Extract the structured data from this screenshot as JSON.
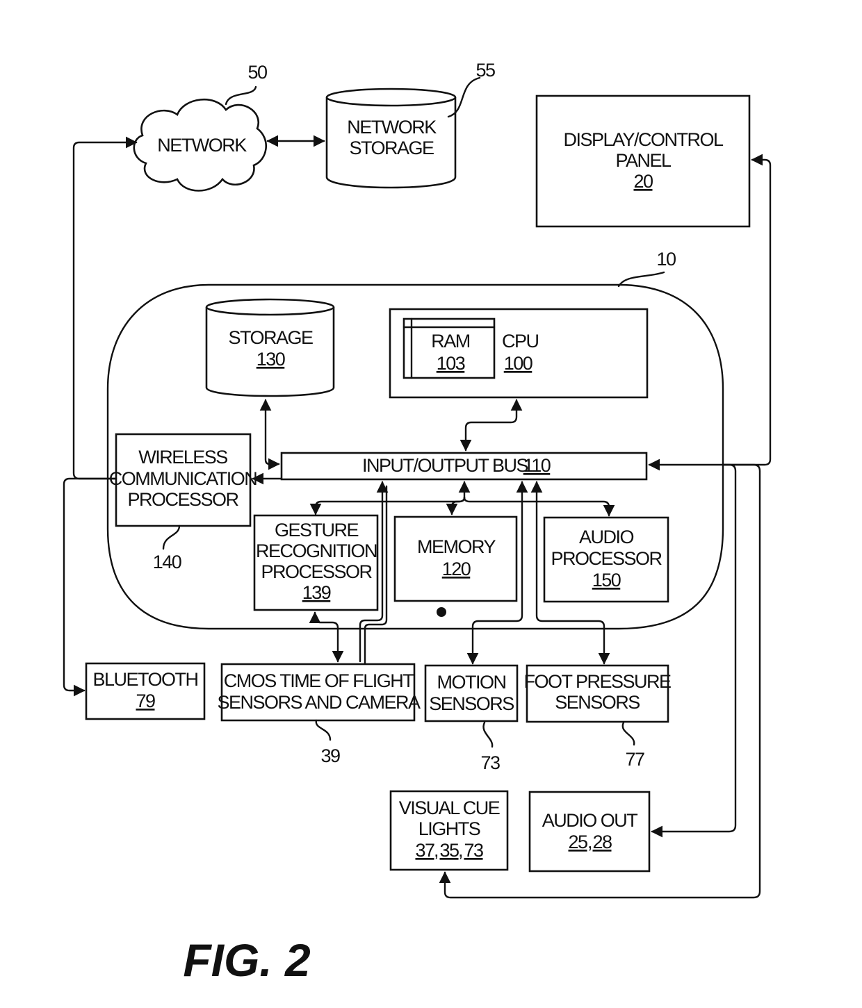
{
  "figure": {
    "title": "FIG. 2",
    "device_ref": "10"
  },
  "network": {
    "label": "NETWORK",
    "ref": "50"
  },
  "network_storage": {
    "line1": "NETWORK",
    "line2": "STORAGE",
    "ref": "55"
  },
  "display_panel": {
    "line1": "DISPLAY/CONTROL",
    "line2": "PANEL",
    "ref": "20"
  },
  "storage": {
    "label": "STORAGE",
    "ref": "130"
  },
  "cpu": {
    "label": "CPU",
    "ref": "100"
  },
  "ram": {
    "label": "RAM",
    "ref": "103"
  },
  "io_bus": {
    "label": "INPUT/OUTPUT BUS",
    "ref": "110"
  },
  "wireless": {
    "line1": "WIRELESS",
    "line2": "COMMUNICATION",
    "line3": "PROCESSOR",
    "ref": "140"
  },
  "gesture": {
    "line1": "GESTURE",
    "line2": "RECOGNITION",
    "line3": "PROCESSOR",
    "ref": "139"
  },
  "memory": {
    "label": "MEMORY",
    "ref": "120"
  },
  "audio_processor": {
    "line1": "AUDIO",
    "line2": "PROCESSOR",
    "ref": "150"
  },
  "bluetooth": {
    "label": "BLUETOOTH",
    "ref": "79"
  },
  "cmos": {
    "line1": "CMOS TIME OF FLIGHT",
    "line2": "SENSORS AND CAMERA",
    "ref": "39"
  },
  "motion": {
    "line1": "MOTION",
    "line2": "SENSORS",
    "ref": "73"
  },
  "foot_pressure": {
    "line1": "FOOT PRESSURE",
    "line2": "SENSORS",
    "ref": "77"
  },
  "visual_cue": {
    "line1": "VISUAL CUE",
    "line2": "LIGHTS",
    "ref_a": "37",
    "ref_b": "35",
    "ref_c": "73",
    "sep": ","
  },
  "audio_out": {
    "label": "AUDIO OUT",
    "ref_a": "25",
    "ref_b": "28",
    "sep": ","
  }
}
